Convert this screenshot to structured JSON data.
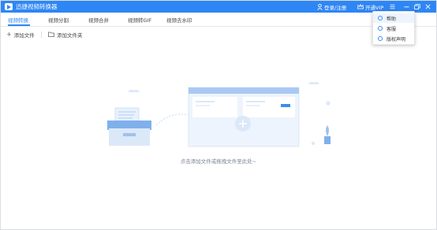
{
  "app": {
    "title": "迅捷视频转换器"
  },
  "titlebar": {
    "login_label": "登录/注册",
    "vip_label": "开通VIP"
  },
  "tabs": [
    {
      "label": "视频转换",
      "active": true
    },
    {
      "label": "视频分割",
      "active": false
    },
    {
      "label": "视频合并",
      "active": false
    },
    {
      "label": "视频转GIF",
      "active": false
    },
    {
      "label": "视频去水印",
      "active": false
    }
  ],
  "toolbar": {
    "add_file_label": "添加文件",
    "add_folder_label": "添加文件夹"
  },
  "main": {
    "hint": "点击添加文件或拖拽文件至此处~"
  },
  "menu": {
    "items": [
      {
        "label": "帮助",
        "icon": "help-icon"
      },
      {
        "label": "客服",
        "icon": "service-icon"
      },
      {
        "label": "版权声明",
        "icon": "copyright-icon"
      }
    ]
  },
  "colors": {
    "accent": "#2e86f5",
    "illustration_light": "#dbe8f8",
    "illustration_mid": "#9fc2ee"
  }
}
